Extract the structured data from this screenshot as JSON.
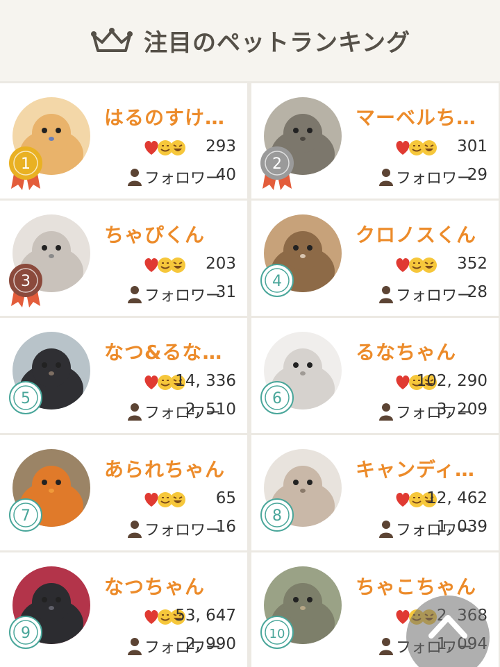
{
  "header": {
    "title": "注目のペットランキング",
    "icon": "crown-icon"
  },
  "colors": {
    "name": "#ec8b2a",
    "gold": "#e9b123",
    "silver": "#9a9a9a",
    "bronze": "#8b4a3c",
    "teal": "#49a69a",
    "ribbon": "#e35d3b"
  },
  "rankings": [
    {
      "rank": "1",
      "name": "はるのすけ…",
      "reactions": "293",
      "follower_label": "フォロワー",
      "followers": "40",
      "medal": "gold"
    },
    {
      "rank": "2",
      "name": "マーベルち…",
      "reactions": "301",
      "follower_label": "フォロワー",
      "followers": "29",
      "medal": "silver"
    },
    {
      "rank": "3",
      "name": "ちゃぴくん",
      "reactions": "203",
      "follower_label": "フォロワー",
      "followers": "31",
      "medal": "bronze"
    },
    {
      "rank": "4",
      "name": "クロノスくん",
      "reactions": "352",
      "follower_label": "フォロワー",
      "followers": "28",
      "medal": "none"
    },
    {
      "rank": "5",
      "name": "なつ&るな…",
      "reactions": "14, 336",
      "follower_label": "フォロワー",
      "followers": "2, 510",
      "medal": "none"
    },
    {
      "rank": "6",
      "name": "るなちゃん",
      "reactions": "102, 290",
      "follower_label": "フォロワー",
      "followers": "3, 209",
      "medal": "none"
    },
    {
      "rank": "7",
      "name": "あられちゃん",
      "reactions": "65",
      "follower_label": "フォロワー",
      "followers": "16",
      "medal": "none"
    },
    {
      "rank": "8",
      "name": "キャンディ…",
      "reactions": "12, 462",
      "follower_label": "フォロワー",
      "followers": "1, 039",
      "medal": "none"
    },
    {
      "rank": "9",
      "name": "なつちゃん",
      "reactions": "53, 647",
      "follower_label": "フォロワー",
      "followers": "2, 990",
      "medal": "none"
    },
    {
      "rank": "10",
      "name": "ちゃこちゃん",
      "reactions": "2, 368",
      "follower_label": "フォロワー",
      "followers": "1, 094",
      "medal": "none"
    }
  ],
  "scroll_top": {
    "icon": "chevron-up-icon"
  }
}
